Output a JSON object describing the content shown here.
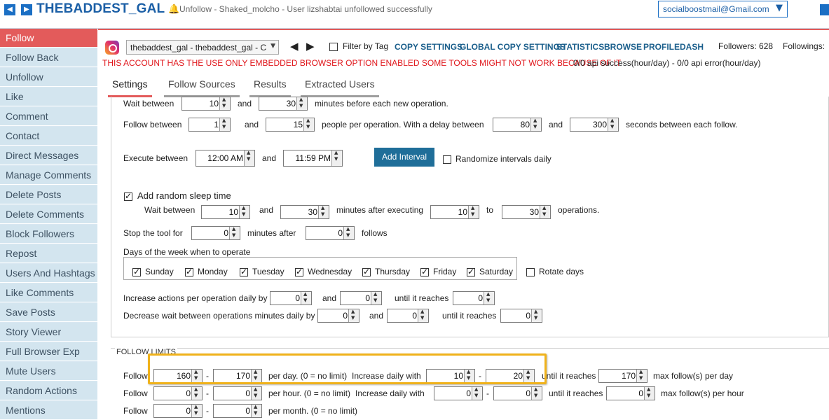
{
  "header": {
    "app_title": "THEBADDEST_GAL",
    "status": "Unfollow - Shaked_molcho - User lizshabtai unfollowed successfully",
    "email": "socialboostmail@Gmail.com"
  },
  "sidebar": {
    "items": [
      "Follow",
      "Follow Back",
      "Unfollow",
      "Like",
      "Comment",
      "Contact",
      "Direct Messages",
      "Manage Comments",
      "Delete Posts",
      "Delete Comments",
      "Block Followers",
      "Repost",
      "Users And Hashtags",
      "Like Comments",
      "Save Posts",
      "Story Viewer",
      "Full Browser Exp",
      "Mute Users",
      "Random Actions",
      "Mentions"
    ],
    "active": "Follow"
  },
  "toolbar": {
    "account": "thebaddest_gal - thebaddest_gal - C",
    "filter_label": "Filter by Tag",
    "links": [
      "COPY SETTINGS",
      "GLOBAL COPY SETTINGS",
      "STATISTICS",
      "BROWSE",
      "PROFILE",
      "DASH"
    ],
    "followers": "Followers: 628",
    "followings": "Followings:"
  },
  "warning": "THIS ACCOUNT HAS THE USE ONLY EMBEDDED BROWSER OPTION ENABLED SOME TOOLS MIGHT NOT WORK BECAUSE OF IT",
  "api_status": "0/0 api success(hour/day) -  0/0 api error(hour/day)",
  "tabs": [
    "Settings",
    "Follow Sources",
    "Results",
    "Extracted Users"
  ],
  "settings": {
    "wait_between": {
      "label": "Wait between",
      "min": "10",
      "and": "and",
      "max": "30",
      "suffix": "minutes before each new operation."
    },
    "follow_between": {
      "label": "Follow between",
      "min": "1",
      "and": "and",
      "max": "15",
      "mid": "people per operation. With a delay between",
      "dmin": "80",
      "and2": "and",
      "dmax": "300",
      "suffix": "seconds between each follow."
    },
    "execute": {
      "label": "Execute between",
      "start": "12:00 AM",
      "and": "and",
      "end": "11:59 PM",
      "add_btn": "Add Interval",
      "randomize": "Randomize intervals daily"
    },
    "sleep": {
      "label": "Add random sleep time",
      "wait": "Wait between",
      "min": "10",
      "and": "and",
      "max": "30",
      "mid": "minutes after executing",
      "omin": "10",
      "to": "to",
      "omax": "30",
      "suffix": "operations."
    },
    "stop": {
      "label": "Stop the tool for",
      "val": "0",
      "mid": "minutes after",
      "val2": "0",
      "suffix": "follows"
    },
    "days": {
      "label": "Days of the week when to operate",
      "list": [
        "Sunday",
        "Monday",
        "Tuesday",
        "Wednesday",
        "Thursday",
        "Friday",
        "Saturday"
      ],
      "rotate": "Rotate days"
    },
    "increase": {
      "label": "Increase actions per operation daily by",
      "a": "0",
      "and": "and",
      "b": "0",
      "until": "until it reaches",
      "c": "0"
    },
    "decrease": {
      "label": "Decrease wait between operations minutes daily by",
      "a": "0",
      "and": "and",
      "b": "0",
      "until": "until it reaches",
      "c": "0"
    }
  },
  "limits": {
    "title": "FOLLOW LIMITS",
    "rows": [
      {
        "label": "Follow",
        "a": "160",
        "dash": "-",
        "b": "170",
        "per": "per day. (0 = no limit)",
        "inc": "Increase daily with",
        "c": "10",
        "dash2": "-",
        "d": "20",
        "until": "until it reaches",
        "e": "170",
        "suffix": "max follow(s) per day"
      },
      {
        "label": "Follow",
        "a": "0",
        "dash": "-",
        "b": "0",
        "per": "per hour. (0 = no limit)",
        "inc": "Increase daily with",
        "c": "0",
        "dash2": "-",
        "d": "0",
        "until": "until it reaches",
        "e": "0",
        "suffix": "max follow(s) per hour"
      },
      {
        "label": "Follow",
        "a": "0",
        "dash": "-",
        "b": "0",
        "per": "per month. (0 = no limit)"
      }
    ]
  }
}
